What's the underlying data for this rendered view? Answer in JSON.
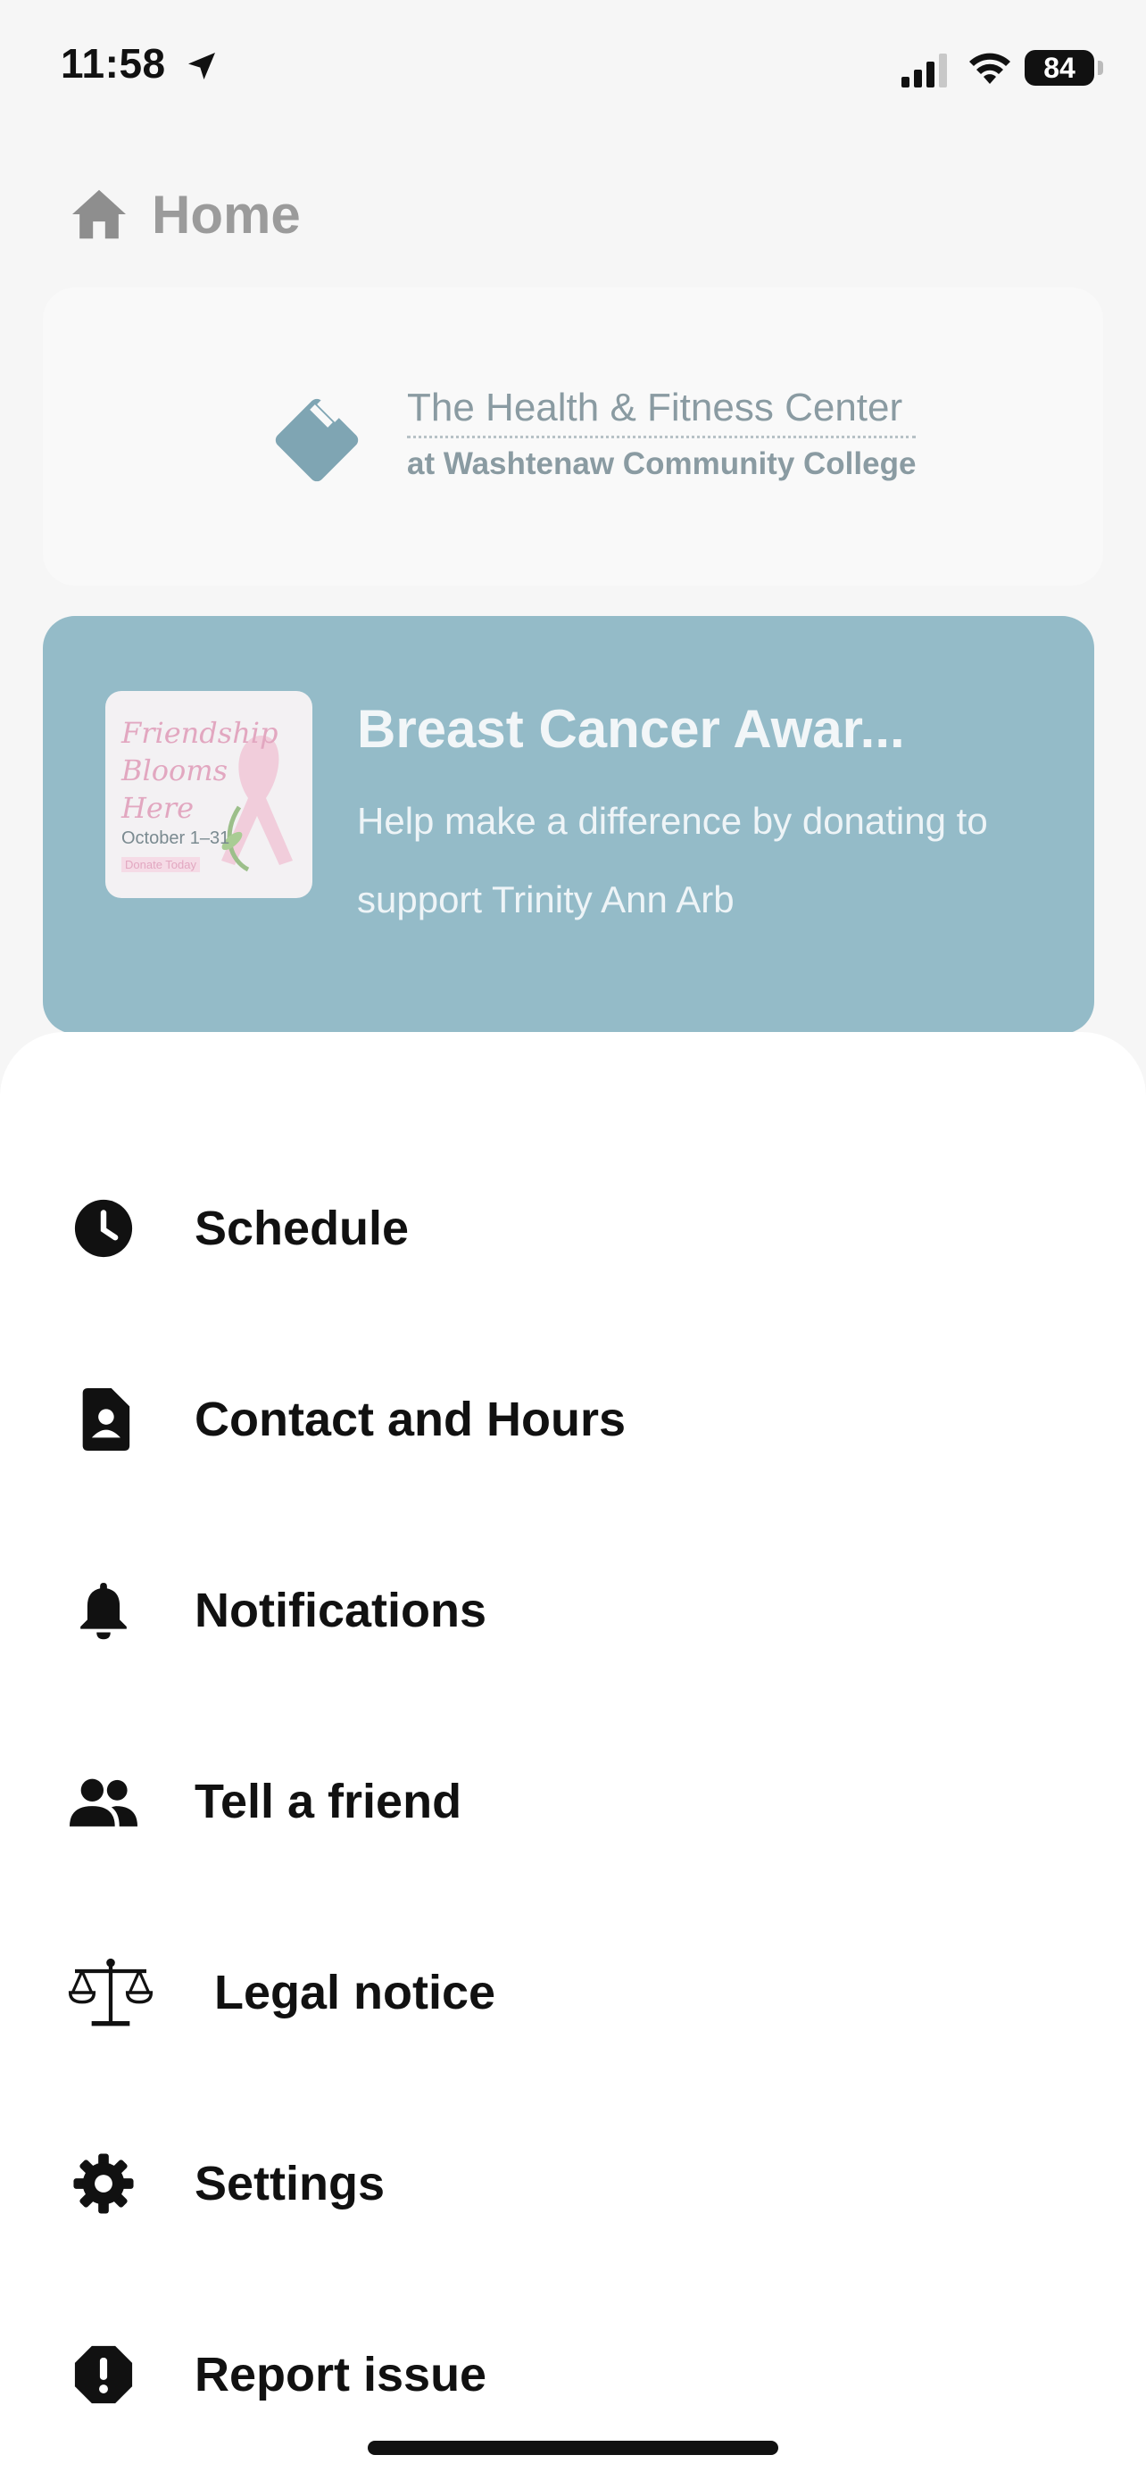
{
  "status_bar": {
    "time": "11:58",
    "battery": "84",
    "icons": [
      "location-arrow-icon",
      "signal-icon",
      "wifi-icon",
      "battery-icon"
    ]
  },
  "header": {
    "icon": "home-icon",
    "title": "Home"
  },
  "logo_card": {
    "line1": "The Health & Fitness Center",
    "line2": "at Washtenaw Community College"
  },
  "promo": {
    "title": "Breast Cancer Awar...",
    "body": "Help make a difference by donating to support Trinity Ann Arb",
    "thumbnail": {
      "line1": "Friendship",
      "line2": "Blooms",
      "line3": "Here",
      "dates": "October 1–31",
      "tag": "Donate Today"
    },
    "background_color": "#94bbc8"
  },
  "menu": {
    "items": [
      {
        "label": "Schedule",
        "icon": "clock-icon"
      },
      {
        "label": "Contact and Hours",
        "icon": "contact-card-icon"
      },
      {
        "label": "Notifications",
        "icon": "bell-icon"
      },
      {
        "label": "Tell a friend",
        "icon": "people-icon"
      },
      {
        "label": "Legal notice",
        "icon": "scales-icon"
      },
      {
        "label": "Settings",
        "icon": "gear-icon"
      },
      {
        "label": "Report issue",
        "icon": "alert-octagon-icon"
      }
    ]
  }
}
